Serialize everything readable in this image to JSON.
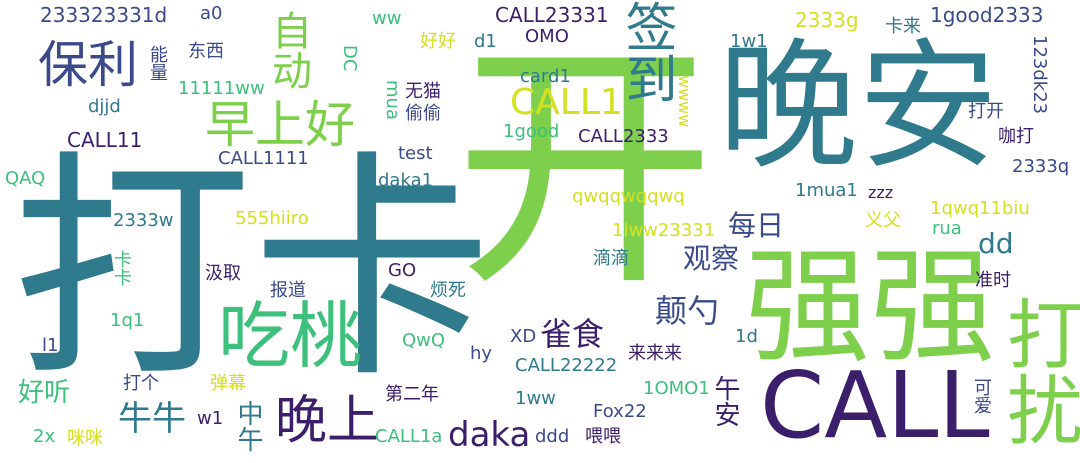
{
  "words": [
    {
      "text": "打卡",
      "color": "#2f7a8c"
    },
    {
      "text": "开",
      "color": "#7ed04c"
    },
    {
      "text": "晚安",
      "color": "#2f7a8c"
    },
    {
      "text": "强强",
      "color": "#7ed04c"
    },
    {
      "text": "CALL",
      "color": "#3b1f6b"
    },
    {
      "text": "打扰",
      "color": "#7ed04c"
    },
    {
      "text": "吃桃",
      "color": "#3cc07c"
    },
    {
      "text": "晚上",
      "color": "#3b1f6b"
    },
    {
      "text": "早上好",
      "color": "#7ed04c"
    },
    {
      "text": "保利",
      "color": "#3a4a8a"
    },
    {
      "text": "签到",
      "color": "#2f7a8c"
    },
    {
      "text": "自动",
      "color": "#7ed04c"
    },
    {
      "text": "CALL1",
      "color": "#d4e020"
    },
    {
      "text": "daka",
      "color": "#3b1f6b"
    },
    {
      "text": "牛牛",
      "color": "#2f7a8c"
    },
    {
      "text": "雀食",
      "color": "#3b1f6b"
    },
    {
      "text": "颠勺",
      "color": "#3a4a8a"
    },
    {
      "text": "观察",
      "color": "#3a4a8a"
    },
    {
      "text": "每日",
      "color": "#3a4a8a"
    },
    {
      "text": "dd",
      "color": "#2f7a8c"
    },
    {
      "text": "好听",
      "color": "#3cc07c"
    },
    {
      "text": "233323331d",
      "color": "#3a4a8a"
    },
    {
      "text": "a0",
      "color": "#3a4a8a"
    },
    {
      "text": "ww",
      "color": "#3cc07c"
    },
    {
      "text": "CALL23331",
      "color": "#3b1f6b"
    },
    {
      "text": "2333g",
      "color": "#d4e020"
    },
    {
      "text": "1good2333",
      "color": "#3a4a8a"
    },
    {
      "text": "卡来",
      "color": "#2f7a8c"
    },
    {
      "text": "东西",
      "color": "#3a4a8a"
    },
    {
      "text": "能量",
      "color": "#3a4a8a"
    },
    {
      "text": "DC",
      "color": "#3cc07c"
    },
    {
      "text": "好好",
      "color": "#d4e020"
    },
    {
      "text": "d1",
      "color": "#2f7a8c"
    },
    {
      "text": "OMO",
      "color": "#3b1f6b"
    },
    {
      "text": "1w1",
      "color": "#2f7a8c"
    },
    {
      "text": "123dk23",
      "color": "#3a4a8a"
    },
    {
      "text": "11111ww",
      "color": "#3cc07c"
    },
    {
      "text": "无猫",
      "color": "#3b1f6b"
    },
    {
      "text": "card1",
      "color": "#2f7a8c"
    },
    {
      "text": "wwww",
      "color": "#d4e020"
    },
    {
      "text": "打开",
      "color": "#3a4a8a"
    },
    {
      "text": "mua",
      "color": "#3cc07c"
    },
    {
      "text": "偷偷",
      "color": "#3a4a8a"
    },
    {
      "text": "djjd",
      "color": "#2f7a8c"
    },
    {
      "text": "1good",
      "color": "#3cc07c"
    },
    {
      "text": "CALL2333",
      "color": "#3b1f6b"
    },
    {
      "text": "咖打",
      "color": "#3b1f6b"
    },
    {
      "text": "CALL11",
      "color": "#3b1f6b"
    },
    {
      "text": "CALL1111",
      "color": "#3a4a8a"
    },
    {
      "text": "test",
      "color": "#3a4a8a"
    },
    {
      "text": "2333q",
      "color": "#3a4a8a"
    },
    {
      "text": "QAQ",
      "color": "#3cc07c"
    },
    {
      "text": "daka1",
      "color": "#2f7a8c"
    },
    {
      "text": "1mua1",
      "color": "#2f7a8c"
    },
    {
      "text": "zzz",
      "color": "#3b1f6b"
    },
    {
      "text": "2333w",
      "color": "#2f7a8c"
    },
    {
      "text": "qwqqwqqwq",
      "color": "#d4e020"
    },
    {
      "text": "1qwq11biu",
      "color": "#d4e020"
    },
    {
      "text": "555hiiro",
      "color": "#d4e020"
    },
    {
      "text": "义父",
      "color": "#d4e020"
    },
    {
      "text": "1lww23331",
      "color": "#d4e020"
    },
    {
      "text": "rua",
      "color": "#3cc07c"
    },
    {
      "text": "滴滴",
      "color": "#2f7a8c"
    },
    {
      "text": "卡卡",
      "color": "#3cc07c"
    },
    {
      "text": "汲取",
      "color": "#3b1f6b"
    },
    {
      "text": "GO",
      "color": "#3b1f6b"
    },
    {
      "text": "准时",
      "color": "#3b1f6b"
    },
    {
      "text": "报道",
      "color": "#3a4a8a"
    },
    {
      "text": "烦死",
      "color": "#2f7a8c"
    },
    {
      "text": "1q1",
      "color": "#3cc07c"
    },
    {
      "text": "l1",
      "color": "#3a4a8a"
    },
    {
      "text": "QwQ",
      "color": "#3cc07c"
    },
    {
      "text": "XD",
      "color": "#3a4a8a"
    },
    {
      "text": "1d",
      "color": "#2f7a8c"
    },
    {
      "text": "hy",
      "color": "#3a4a8a"
    },
    {
      "text": "来来来",
      "color": "#3b1f6b"
    },
    {
      "text": "CALL22222",
      "color": "#2f7a8c"
    },
    {
      "text": "打个",
      "color": "#3a4a8a"
    },
    {
      "text": "弹幕",
      "color": "#d4e020"
    },
    {
      "text": "1OMO1",
      "color": "#3cc07c"
    },
    {
      "text": "午安",
      "color": "#3b1f6b"
    },
    {
      "text": "可爱",
      "color": "#3a4a8a"
    },
    {
      "text": "第二年",
      "color": "#3b1f6b"
    },
    {
      "text": "1ww",
      "color": "#2f7a8c"
    },
    {
      "text": "w1",
      "color": "#3b1f6b"
    },
    {
      "text": "中午",
      "color": "#2f7a8c"
    },
    {
      "text": "Fox22",
      "color": "#3a4a8a"
    },
    {
      "text": "2x",
      "color": "#3cc07c"
    },
    {
      "text": "咪咪",
      "color": "#d4e020"
    },
    {
      "text": "CALL1a",
      "color": "#3cc07c"
    },
    {
      "text": "ddd",
      "color": "#3a4a8a"
    },
    {
      "text": "喂喂",
      "color": "#3b1f6b"
    }
  ]
}
